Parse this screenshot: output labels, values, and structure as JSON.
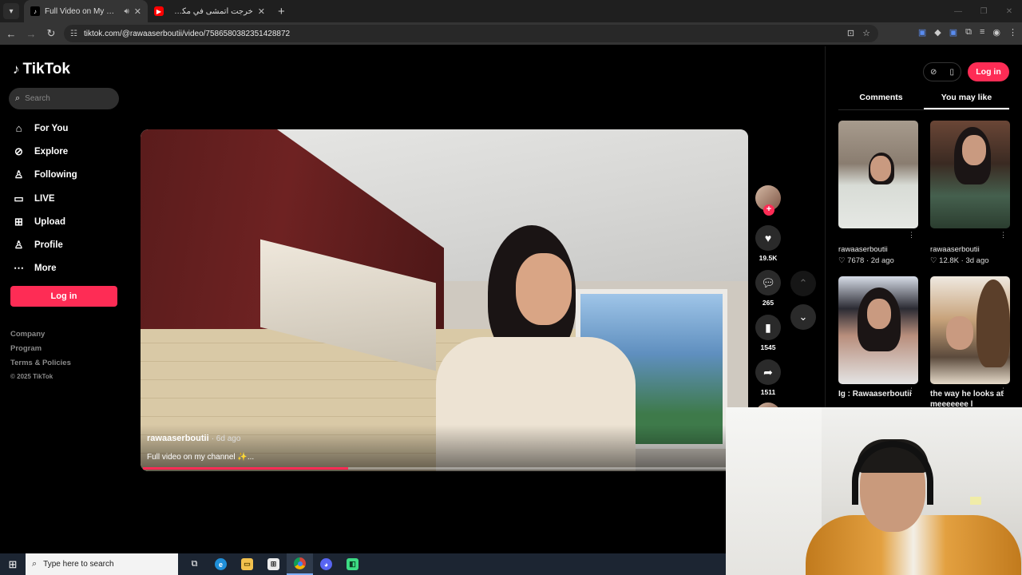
{
  "browser": {
    "tabs": [
      {
        "title": "Full Video on My Channel |",
        "active": true
      },
      {
        "title": "خرجت أتمشى في مكسيكو... وانعر",
        "active": false
      }
    ],
    "url": "tiktok.com/@rawaaserboutii/video/7586580382351428872"
  },
  "tiktok": {
    "logo_text": "TikTok",
    "search_placeholder": "Search",
    "nav": [
      {
        "label": "For You",
        "icon": "home-icon"
      },
      {
        "label": "Explore",
        "icon": "compass-icon"
      },
      {
        "label": "Following",
        "icon": "following-icon"
      },
      {
        "label": "LIVE",
        "icon": "live-icon"
      },
      {
        "label": "Upload",
        "icon": "upload-icon"
      },
      {
        "label": "Profile",
        "icon": "profile-icon"
      },
      {
        "label": "More",
        "icon": "more-icon"
      }
    ],
    "login_label": "Log in",
    "footer": [
      "Company",
      "Program",
      "Terms & Policies"
    ],
    "copyright": "© 2025 TikTok"
  },
  "video": {
    "author": "rawaaserboutii",
    "ago": "· 6d ago",
    "caption": "Full video on my channel ✨...",
    "progress_fraction": 0.34
  },
  "actions": {
    "likes": "19.5K",
    "comments": "265",
    "saves": "1545",
    "shares": "1511"
  },
  "right_panel": {
    "login_label": "Log in",
    "tabs": [
      "Comments",
      "You may like"
    ],
    "selected_tab": "You may like",
    "cards": [
      {
        "author": "rawaaserboutii",
        "likes": "7678",
        "ago": "2d ago"
      },
      {
        "author": "rawaaserboutii",
        "likes": "12.8K",
        "ago": "3d ago"
      },
      {
        "caption": "Ig : Rawaaserboutii"
      },
      {
        "caption": "the way he looks at meeeeeee l"
      }
    ]
  },
  "taskbar": {
    "search_placeholder": "Type here to search"
  },
  "colors": {
    "accent": "#fe2c55",
    "background": "#000000"
  }
}
